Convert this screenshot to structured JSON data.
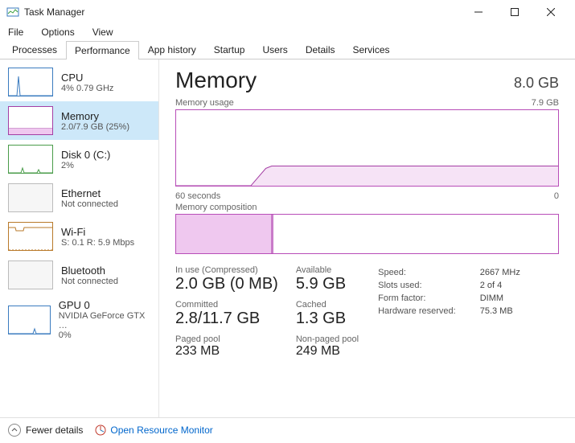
{
  "window": {
    "title": "Task Manager"
  },
  "menu": {
    "file": "File",
    "options": "Options",
    "view": "View"
  },
  "tabs": {
    "processes": "Processes",
    "performance": "Performance",
    "apphistory": "App history",
    "startup": "Startup",
    "users": "Users",
    "details": "Details",
    "services": "Services"
  },
  "sidebar": {
    "cpu": {
      "title": "CPU",
      "sub": "4%  0.79 GHz"
    },
    "memory": {
      "title": "Memory",
      "sub": "2.0/7.9 GB (25%)"
    },
    "disk": {
      "title": "Disk 0 (C:)",
      "sub": "2%"
    },
    "ethernet": {
      "title": "Ethernet",
      "sub": "Not connected"
    },
    "wifi": {
      "title": "Wi-Fi",
      "sub": "S: 0.1  R: 5.9 Mbps"
    },
    "bluetooth": {
      "title": "Bluetooth",
      "sub": "Not connected"
    },
    "gpu": {
      "title": "GPU 0",
      "sub": "NVIDIA GeForce GTX …",
      "sub2": "0%"
    }
  },
  "main": {
    "title": "Memory",
    "capacity": "8.0 GB",
    "usage_label": "Memory usage",
    "usage_max": "7.9 GB",
    "time_left": "60 seconds",
    "time_right": "0",
    "comp_label": "Memory composition",
    "inuse_label": "In use (Compressed)",
    "inuse_val": "2.0 GB (0 MB)",
    "avail_label": "Available",
    "avail_val": "5.9 GB",
    "committed_label": "Committed",
    "committed_val": "2.8/11.7 GB",
    "cached_label": "Cached",
    "cached_val": "1.3 GB",
    "paged_label": "Paged pool",
    "paged_val": "233 MB",
    "nonpaged_label": "Non-paged pool",
    "nonpaged_val": "249 MB",
    "kv": {
      "speed_k": "Speed:",
      "speed_v": "2667 MHz",
      "slots_k": "Slots used:",
      "slots_v": "2 of 4",
      "form_k": "Form factor:",
      "form_v": "DIMM",
      "hw_k": "Hardware reserved:",
      "hw_v": "75.3 MB"
    }
  },
  "footer": {
    "fewer": "Fewer details",
    "orm": "Open Resource Monitor"
  },
  "chart_data": {
    "type": "line",
    "title": "Memory usage",
    "xlabel": "seconds",
    "ylabel": "GB",
    "ylim": [
      0,
      7.9
    ],
    "x_range_label": [
      "60 seconds",
      "0"
    ],
    "series": [
      {
        "name": "In use",
        "x": [
          60,
          50,
          48,
          47,
          40,
          30,
          20,
          10,
          0
        ],
        "values": [
          0,
          0,
          1.6,
          2.0,
          2.0,
          2.0,
          2.0,
          2.0,
          2.0
        ]
      }
    ],
    "composition": {
      "type": "bar",
      "segments": [
        {
          "name": "In use",
          "value": 2.0
        },
        {
          "name": "Available",
          "value": 5.9
        }
      ],
      "total": 7.9
    }
  }
}
